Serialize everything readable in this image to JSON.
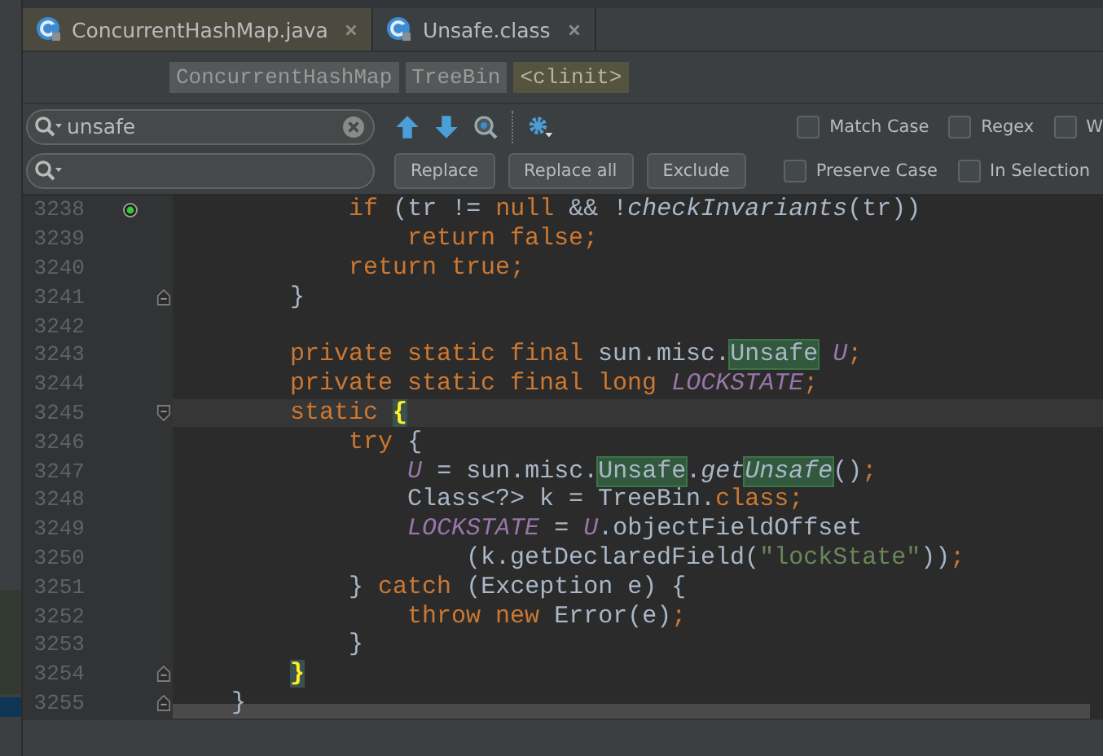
{
  "tabs": [
    {
      "label": "ConcurrentHashMap.java",
      "selected": true
    },
    {
      "label": "Unsafe.class",
      "selected": false
    }
  ],
  "breadcrumbs": [
    {
      "label": "ConcurrentHashMap",
      "selected": false
    },
    {
      "label": "TreeBin",
      "selected": false
    },
    {
      "label": "<clinit>",
      "selected": true
    }
  ],
  "find": {
    "value": "unsafe"
  },
  "find_options": [
    {
      "label": "Match Case",
      "checked": false
    },
    {
      "label": "Regex",
      "checked": false
    },
    {
      "label": "W",
      "checked": false
    }
  ],
  "replace_buttons": [
    "Replace",
    "Replace all",
    "Exclude"
  ],
  "replace_options": [
    {
      "label": "Preserve Case",
      "checked": false
    },
    {
      "label": "In Selection",
      "checked": false
    }
  ],
  "editor": {
    "lines": [
      {
        "number": "3238",
        "current": false,
        "marker": true,
        "fold_start": false,
        "fold_end": false,
        "code": [
          {
            "kind": "kw",
            "text": "            if"
          },
          {
            "kind": "plain",
            "text": " (tr != "
          },
          {
            "kind": "kw",
            "text": "null"
          },
          {
            "kind": "plain",
            "text": " && !"
          },
          {
            "kind": "method",
            "text": "checkInvariants"
          },
          {
            "kind": "plain",
            "text": "(tr))"
          }
        ]
      },
      {
        "number": "3239",
        "current": false,
        "marker": false,
        "fold_start": false,
        "fold_end": false,
        "code": [
          {
            "kind": "kw",
            "text": "                return false;"
          }
        ]
      },
      {
        "number": "3240",
        "current": false,
        "marker": false,
        "fold_start": false,
        "fold_end": false,
        "code": [
          {
            "kind": "kw",
            "text": "            return true;"
          }
        ]
      },
      {
        "number": "3241",
        "current": false,
        "marker": false,
        "fold_start": false,
        "fold_end": true,
        "code": [
          {
            "kind": "plain",
            "text": "        }"
          }
        ]
      },
      {
        "number": "3242",
        "current": false,
        "marker": false,
        "fold_start": false,
        "fold_end": false
      },
      {
        "number": "3243",
        "current": false,
        "marker": false,
        "fold_start": false,
        "fold_end": false,
        "code": [
          {
            "kind": "kw",
            "text": "        private static final "
          },
          {
            "kind": "plain",
            "text": "sun.misc."
          },
          {
            "kind": "match",
            "text": "Unsafe"
          },
          {
            "kind": "field",
            "text": " U"
          },
          {
            "kind": "kw",
            "text": ";"
          }
        ]
      },
      {
        "number": "3244",
        "current": false,
        "marker": false,
        "fold_start": false,
        "fold_end": false,
        "code": [
          {
            "kind": "kw",
            "text": "        private static final long "
          },
          {
            "kind": "field",
            "text": "LOCKSTATE"
          },
          {
            "kind": "kw",
            "text": ";"
          }
        ]
      },
      {
        "number": "3245",
        "current": true,
        "marker": false,
        "fold_start": true,
        "fold_end": false,
        "code": [
          {
            "kind": "kw",
            "text": "        static "
          },
          {
            "kind": "brace",
            "text": "{"
          }
        ]
      },
      {
        "number": "3246",
        "current": false,
        "marker": false,
        "fold_start": false,
        "fold_end": false,
        "code": [
          {
            "kind": "kw",
            "text": "            try"
          },
          {
            "kind": "plain",
            "text": " {"
          }
        ]
      },
      {
        "number": "3247",
        "current": false,
        "marker": false,
        "fold_start": false,
        "fold_end": false,
        "code": [
          {
            "kind": "field",
            "text": "                U"
          },
          {
            "kind": "plain",
            "text": " = sun.misc."
          },
          {
            "kind": "match",
            "text": "Unsafe"
          },
          {
            "kind": "plain",
            "text": "."
          },
          {
            "kind": "method",
            "text": "get"
          },
          {
            "kind": "match-method",
            "text": "Unsafe"
          },
          {
            "kind": "plain",
            "text": "()"
          },
          {
            "kind": "kw",
            "text": ";"
          }
        ]
      },
      {
        "number": "3248",
        "current": false,
        "marker": false,
        "fold_start": false,
        "fold_end": false,
        "code": [
          {
            "kind": "plain",
            "text": "                Class<?> k = TreeBin."
          },
          {
            "kind": "kw",
            "text": "class;"
          }
        ]
      },
      {
        "number": "3249",
        "current": false,
        "marker": false,
        "fold_start": false,
        "fold_end": false,
        "code": [
          {
            "kind": "field",
            "text": "                LOCKSTATE"
          },
          {
            "kind": "plain",
            "text": " = "
          },
          {
            "kind": "field",
            "text": "U"
          },
          {
            "kind": "plain",
            "text": ".objectFieldOffset"
          }
        ]
      },
      {
        "number": "3250",
        "current": false,
        "marker": false,
        "fold_start": false,
        "fold_end": false,
        "code": [
          {
            "kind": "plain",
            "text": "                    (k.getDeclaredField("
          },
          {
            "kind": "str",
            "text": "\"lockState\""
          },
          {
            "kind": "plain",
            "text": "))"
          },
          {
            "kind": "kw",
            "text": ";"
          }
        ]
      },
      {
        "number": "3251",
        "current": false,
        "marker": false,
        "fold_start": false,
        "fold_end": false,
        "code": [
          {
            "kind": "plain",
            "text": "            } "
          },
          {
            "kind": "kw",
            "text": "catch"
          },
          {
            "kind": "plain",
            "text": " (Exception e) {"
          }
        ]
      },
      {
        "number": "3252",
        "current": false,
        "marker": false,
        "fold_start": false,
        "fold_end": false,
        "code": [
          {
            "kind": "kw",
            "text": "                throw new"
          },
          {
            "kind": "plain",
            "text": " Error(e)"
          },
          {
            "kind": "kw",
            "text": ";"
          }
        ]
      },
      {
        "number": "3253",
        "current": false,
        "marker": false,
        "fold_start": false,
        "fold_end": false,
        "code": [
          {
            "kind": "plain",
            "text": "            }"
          }
        ]
      },
      {
        "number": "3254",
        "current": false,
        "marker": false,
        "fold_start": false,
        "fold_end": true,
        "code": [
          {
            "kind": "brace",
            "text": "        }"
          }
        ]
      },
      {
        "number": "3255",
        "current": false,
        "marker": false,
        "fold_start": false,
        "fold_end": true,
        "code": [
          {
            "kind": "plain",
            "text": "    }"
          }
        ]
      }
    ]
  }
}
